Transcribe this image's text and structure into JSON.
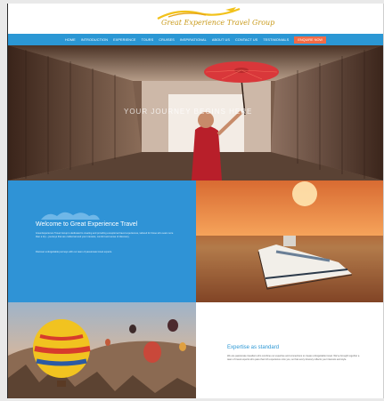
{
  "header": {
    "logo_text": "Great Experience Travel Group"
  },
  "nav": {
    "items": [
      "Home",
      "Introduction",
      "Experience",
      "Tours",
      "Cruises",
      "Inspirational",
      "About Us",
      "Contact Us",
      "Testimonials"
    ],
    "cta": "Enquire Now"
  },
  "hero": {
    "tagline": "Your Journey Begins Here"
  },
  "welcome": {
    "title": "Welcome to Great Experience Travel",
    "body": "Great Experience Travel Group is dedicated to creating and providing exceptional travel experiences, tailored for those who seek more than a trip – journeys that are crafted around your interests, comfort and sense of discovery.",
    "body2": "Discover unforgettable journeys with our team of passionate travel experts."
  },
  "expertise": {
    "title": "Expertise as standard",
    "body": "We are passionate travellers who combine our expertise and connections to create unforgettable travel. We've brought together a team of travel experts who pass that rich experience onto you, so that every itinerary reflects your interests and style."
  },
  "colors": {
    "nav": "#2b97d4",
    "cta": "#f36b45",
    "welcome_bg": "#2f93d6",
    "accent": "#c99a1a"
  }
}
